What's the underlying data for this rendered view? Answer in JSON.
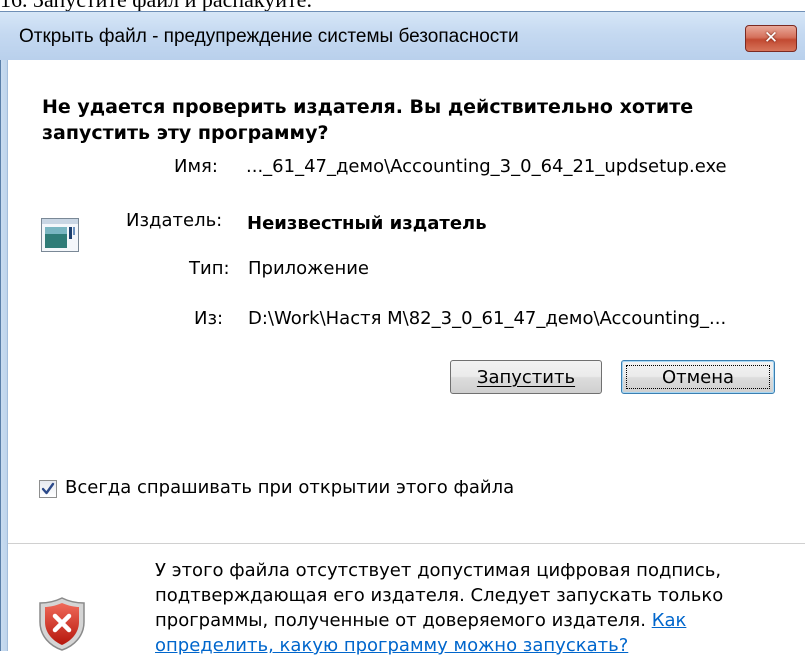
{
  "document": {
    "caption": "16. Запустите файл и распакуйте."
  },
  "dialog": {
    "title": "Открыть файл - предупреждение системы безопасности",
    "close_label": "✕",
    "heading": "Не удается проверить издателя.  Вы действительно хотите запустить эту программу?",
    "fields": {
      "name": {
        "label": "Имя:",
        "value": "..._61_47_демо\\Accounting_3_0_64_21_updsetup.exe"
      },
      "publisher": {
        "label": "Издатель:",
        "value": "Неизвестный издатель"
      },
      "type": {
        "label": "Тип:",
        "value": "Приложение"
      },
      "from": {
        "label": "Из:",
        "value": "D:\\Work\\Настя М\\82_3_0_61_47_демо\\Accounting_..."
      }
    },
    "buttons": {
      "run_label": "Запустить",
      "cancel_label": "Отмена"
    },
    "always_ask": {
      "label": "Всегда спрашивать при открытии этого файла",
      "checked": true
    },
    "warning": {
      "text": "У этого файла отсутствует допустимая цифровая подпись, подтверждающая его издателя.  Следует запускать только программы, полученные от доверяемого издателя.  ",
      "link": "Как определить, какую программу можно запускать?"
    },
    "icons": {
      "app": "application-window-icon",
      "close": "close-icon",
      "shield": "security-shield-error-icon",
      "check": "checkmark-icon"
    },
    "colors": {
      "titlebar": "#c5d9f1",
      "close_button": "#c24a32",
      "link": "#0066cc",
      "default_button_border": "#3c7fb1"
    }
  }
}
